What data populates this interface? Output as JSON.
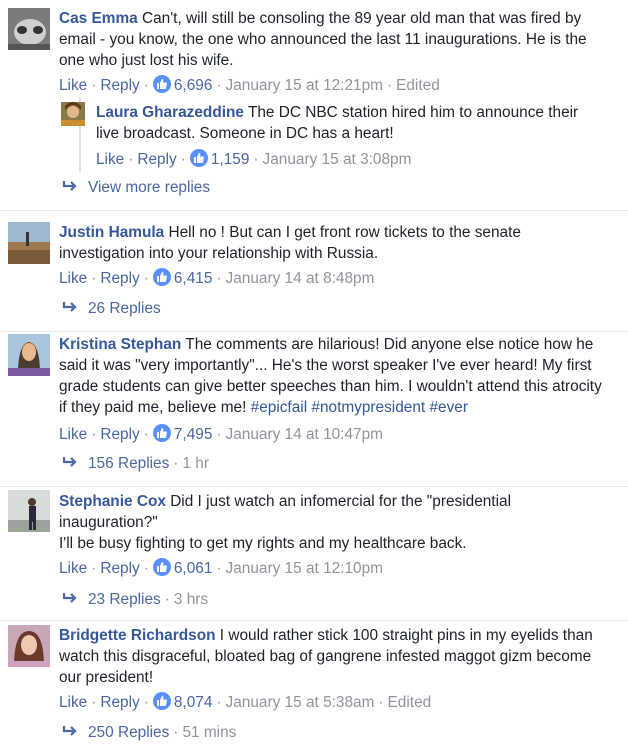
{
  "comments": [
    {
      "author": "Cas Emma",
      "text_lines": [
        "Can't, will still be consoling the 89 year old man that was fired by",
        "email - you know, the one who announced the last 11 inaugurations. He is the",
        "one who just lost his wife."
      ],
      "like_label": "Like",
      "reply_label": "Reply",
      "likes": "6,696",
      "time": "January 15 at 12:21pm",
      "edited": "Edited",
      "reply": {
        "author": "Laura Gharazeddine",
        "text_lines": [
          "The DC NBC station hired him to announce their",
          "live broadcast. Someone in DC has a heart!"
        ],
        "like_label": "Like",
        "reply_label": "Reply",
        "likes": "1,159",
        "time": "January 15 at 3:08pm"
      },
      "more_replies": "View more replies"
    },
    {
      "author": "Justin Hamula",
      "text_lines": [
        "Hell no ! But can I get front row tickets to the senate",
        "investigation into your relationship with Russia."
      ],
      "like_label": "Like",
      "reply_label": "Reply",
      "likes": "6,415",
      "time": "January 14 at 8:48pm",
      "replies": "26 Replies",
      "replies_time": ""
    },
    {
      "author": "Kristina Stephan",
      "text_lines": [
        "The comments are hilarious! Did anyone else notice how he",
        "said it was \"very importantly\"... He's the worst speaker I've ever heard! My first",
        "grade students can give better speeches than him. I wouldn't attend this atrocity",
        "if they paid me, believe me!"
      ],
      "hashtags": [
        "#epicfail",
        "#notmypresident",
        "#ever"
      ],
      "like_label": "Like",
      "reply_label": "Reply",
      "likes": "7,495",
      "time": "January 14 at 10:47pm",
      "replies": "156 Replies",
      "replies_time": "1 hr"
    },
    {
      "author": "Stephanie Cox",
      "text_lines": [
        "Did I just watch an infomercial for the \"presidential",
        "inauguration?\"",
        "I'll be busy fighting to get my rights and my healthcare back."
      ],
      "like_label": "Like",
      "reply_label": "Reply",
      "likes": "6,061",
      "time": "January 15 at 12:10pm",
      "replies": "23 Replies",
      "replies_time": "3 hrs"
    },
    {
      "author": "Bridgette Richardson",
      "text_lines": [
        "I would rather stick 100 straight pins in my eyelids than",
        "watch this disgraceful, bloated bag of gangrene infested maggot gizm become",
        "our president!"
      ],
      "like_label": "Like",
      "reply_label": "Reply",
      "likes": "8,074",
      "time": "January 15 at 5:38am",
      "edited": "Edited",
      "replies": "250 Replies",
      "replies_time": "51 mins"
    }
  ],
  "colors": {
    "link": "#365899",
    "meta": "#90949c",
    "like_badge": "#5890ff"
  }
}
